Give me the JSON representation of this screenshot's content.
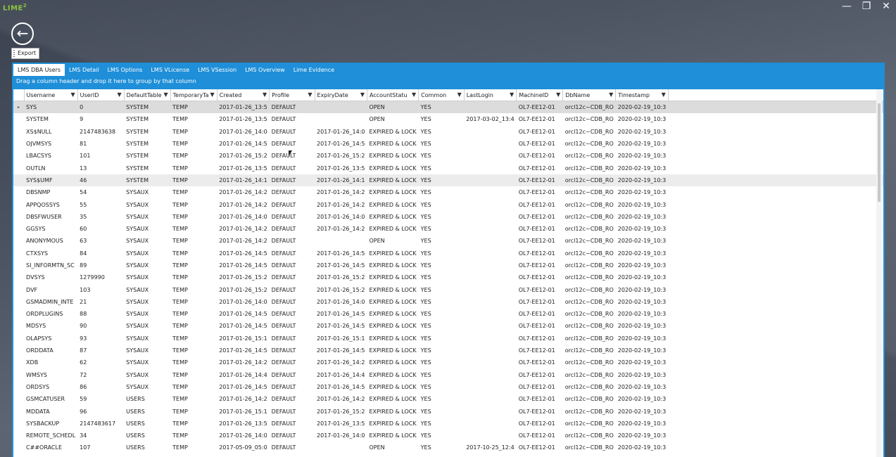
{
  "app": {
    "logo_text": "LIME",
    "logo_sup": "2"
  },
  "window_controls": {
    "minimize": "—",
    "maximize": "❐",
    "close": "✕"
  },
  "toolbar": {
    "export_label": "Export"
  },
  "tabs": [
    {
      "label": "LMS DBA Users",
      "active": true
    },
    {
      "label": "LMS Detail",
      "active": false
    },
    {
      "label": "LMS Options",
      "active": false
    },
    {
      "label": "LMS VLicense",
      "active": false
    },
    {
      "label": "LMS VSession",
      "active": false
    },
    {
      "label": "LMS Overview",
      "active": false
    },
    {
      "label": "Lime Evidence",
      "active": false
    }
  ],
  "group_hint": "Drag a column header and drop it here to group by that column",
  "grid": {
    "columns": [
      "Username",
      "UserID",
      "DefaultTable",
      "TemporaryTa",
      "Created",
      "Profile",
      "ExpiryDate",
      "AccountStatu",
      "Common",
      "LastLogin",
      "MachineID",
      "DbName",
      "Timestamp"
    ],
    "rows": [
      [
        "SYS",
        "0",
        "SYSTEM",
        "TEMP",
        "2017-01-26_13:5",
        "DEFAULT",
        "",
        "OPEN",
        "YES",
        "",
        "OL7-EE12-01",
        "orcl12c~CDB_RO",
        "2020-02-19_10:3"
      ],
      [
        "SYSTEM",
        "9",
        "SYSTEM",
        "TEMP",
        "2017-01-26_13:5",
        "DEFAULT",
        "",
        "OPEN",
        "YES",
        "2017-03-02_13:4",
        "OL7-EE12-01",
        "orcl12c~CDB_RO",
        "2020-02-19_10:3"
      ],
      [
        "XS$NULL",
        "2147483638",
        "SYSTEM",
        "TEMP",
        "2017-01-26_14:0",
        "DEFAULT",
        "2017-01-26_14:0",
        "EXPIRED & LOCK",
        "YES",
        "",
        "OL7-EE12-01",
        "orcl12c~CDB_RO",
        "2020-02-19_10:3"
      ],
      [
        "OJVMSYS",
        "81",
        "SYSTEM",
        "TEMP",
        "2017-01-26_14:5",
        "DEFAULT",
        "2017-01-26_14:5",
        "EXPIRED & LOCK",
        "YES",
        "",
        "OL7-EE12-01",
        "orcl12c~CDB_RO",
        "2020-02-19_10:3"
      ],
      [
        "LBACSYS",
        "101",
        "SYSTEM",
        "TEMP",
        "2017-01-26_15:2",
        "DEFAULT",
        "2017-01-26_15:2",
        "EXPIRED & LOCK",
        "YES",
        "",
        "OL7-EE12-01",
        "orcl12c~CDB_RO",
        "2020-02-19_10:3"
      ],
      [
        "OUTLN",
        "13",
        "SYSTEM",
        "TEMP",
        "2017-01-26_13:5",
        "DEFAULT",
        "2017-01-26_13:5",
        "EXPIRED & LOCK",
        "YES",
        "",
        "OL7-EE12-01",
        "orcl12c~CDB_RO",
        "2020-02-19_10:3"
      ],
      [
        "SYS$UMF",
        "46",
        "SYSTEM",
        "TEMP",
        "2017-01-26_14:1",
        "DEFAULT",
        "2017-01-26_14:1",
        "EXPIRED & LOCK",
        "YES",
        "",
        "OL7-EE12-01",
        "orcl12c~CDB_RO",
        "2020-02-19_10:3"
      ],
      [
        "DBSNMP",
        "54",
        "SYSAUX",
        "TEMP",
        "2017-01-26_14:2",
        "DEFAULT",
        "2017-01-26_14:2",
        "EXPIRED & LOCK",
        "YES",
        "",
        "OL7-EE12-01",
        "orcl12c~CDB_RO",
        "2020-02-19_10:3"
      ],
      [
        "APPQOSSYS",
        "55",
        "SYSAUX",
        "TEMP",
        "2017-01-26_14:2",
        "DEFAULT",
        "2017-01-26_14:2",
        "EXPIRED & LOCK",
        "YES",
        "",
        "OL7-EE12-01",
        "orcl12c~CDB_RO",
        "2020-02-19_10:3"
      ],
      [
        "DBSFWUSER",
        "35",
        "SYSAUX",
        "TEMP",
        "2017-01-26_14:0",
        "DEFAULT",
        "2017-01-26_14:0",
        "EXPIRED & LOCK",
        "YES",
        "",
        "OL7-EE12-01",
        "orcl12c~CDB_RO",
        "2020-02-19_10:3"
      ],
      [
        "GGSYS",
        "60",
        "SYSAUX",
        "TEMP",
        "2017-01-26_14:2",
        "DEFAULT",
        "2017-01-26_14:2",
        "EXPIRED & LOCK",
        "YES",
        "",
        "OL7-EE12-01",
        "orcl12c~CDB_RO",
        "2020-02-19_10:3"
      ],
      [
        "ANONYMOUS",
        "63",
        "SYSAUX",
        "TEMP",
        "2017-01-26_14:2",
        "DEFAULT",
        "",
        "OPEN",
        "YES",
        "",
        "OL7-EE12-01",
        "orcl12c~CDB_RO",
        "2020-02-19_10:3"
      ],
      [
        "CTXSYS",
        "84",
        "SYSAUX",
        "TEMP",
        "2017-01-26_14:5",
        "DEFAULT",
        "2017-01-26_14:5",
        "EXPIRED & LOCK",
        "YES",
        "",
        "OL7-EE12-01",
        "orcl12c~CDB_RO",
        "2020-02-19_10:3"
      ],
      [
        "SI_INFORMTN_SC",
        "89",
        "SYSAUX",
        "TEMP",
        "2017-01-26_14:5",
        "DEFAULT",
        "2017-01-26_14:5",
        "EXPIRED & LOCK",
        "YES",
        "",
        "OL7-EE12-01",
        "orcl12c~CDB_RO",
        "2020-02-19_10:3"
      ],
      [
        "DVSYS",
        "1279990",
        "SYSAUX",
        "TEMP",
        "2017-01-26_15:2",
        "DEFAULT",
        "2017-01-26_15:2",
        "EXPIRED & LOCK",
        "YES",
        "",
        "OL7-EE12-01",
        "orcl12c~CDB_RO",
        "2020-02-19_10:3"
      ],
      [
        "DVF",
        "103",
        "SYSAUX",
        "TEMP",
        "2017-01-26_15:2",
        "DEFAULT",
        "2017-01-26_15:2",
        "EXPIRED & LOCK",
        "YES",
        "",
        "OL7-EE12-01",
        "orcl12c~CDB_RO",
        "2020-02-19_10:3"
      ],
      [
        "GSMADMIN_INTE",
        "21",
        "SYSAUX",
        "TEMP",
        "2017-01-26_14:0",
        "DEFAULT",
        "2017-01-26_14:0",
        "EXPIRED & LOCK",
        "YES",
        "",
        "OL7-EE12-01",
        "orcl12c~CDB_RO",
        "2020-02-19_10:3"
      ],
      [
        "ORDPLUGINS",
        "88",
        "SYSAUX",
        "TEMP",
        "2017-01-26_14:5",
        "DEFAULT",
        "2017-01-26_14:5",
        "EXPIRED & LOCK",
        "YES",
        "",
        "OL7-EE12-01",
        "orcl12c~CDB_RO",
        "2020-02-19_10:3"
      ],
      [
        "MDSYS",
        "90",
        "SYSAUX",
        "TEMP",
        "2017-01-26_14:5",
        "DEFAULT",
        "2017-01-26_14:5",
        "EXPIRED & LOCK",
        "YES",
        "",
        "OL7-EE12-01",
        "orcl12c~CDB_RO",
        "2020-02-19_10:3"
      ],
      [
        "OLAPSYS",
        "93",
        "SYSAUX",
        "TEMP",
        "2017-01-26_15:1",
        "DEFAULT",
        "2017-01-26_15:1",
        "EXPIRED & LOCK",
        "YES",
        "",
        "OL7-EE12-01",
        "orcl12c~CDB_RO",
        "2020-02-19_10:3"
      ],
      [
        "ORDDATA",
        "87",
        "SYSAUX",
        "TEMP",
        "2017-01-26_14:5",
        "DEFAULT",
        "2017-01-26_14:5",
        "EXPIRED & LOCK",
        "YES",
        "",
        "OL7-EE12-01",
        "orcl12c~CDB_RO",
        "2020-02-19_10:3"
      ],
      [
        "XDB",
        "62",
        "SYSAUX",
        "TEMP",
        "2017-01-26_14:2",
        "DEFAULT",
        "2017-01-26_14:2",
        "EXPIRED & LOCK",
        "YES",
        "",
        "OL7-EE12-01",
        "orcl12c~CDB_RO",
        "2020-02-19_10:3"
      ],
      [
        "WMSYS",
        "72",
        "SYSAUX",
        "TEMP",
        "2017-01-26_14:4",
        "DEFAULT",
        "2017-01-26_14:4",
        "EXPIRED & LOCK",
        "YES",
        "",
        "OL7-EE12-01",
        "orcl12c~CDB_RO",
        "2020-02-19_10:3"
      ],
      [
        "ORDSYS",
        "86",
        "SYSAUX",
        "TEMP",
        "2017-01-26_14:5",
        "DEFAULT",
        "2017-01-26_14:5",
        "EXPIRED & LOCK",
        "YES",
        "",
        "OL7-EE12-01",
        "orcl12c~CDB_RO",
        "2020-02-19_10:3"
      ],
      [
        "GSMCATUSER",
        "59",
        "USERS",
        "TEMP",
        "2017-01-26_14:2",
        "DEFAULT",
        "2017-01-26_14:2",
        "EXPIRED & LOCK",
        "YES",
        "",
        "OL7-EE12-01",
        "orcl12c~CDB_RO",
        "2020-02-19_10:3"
      ],
      [
        "MDDATA",
        "96",
        "USERS",
        "TEMP",
        "2017-01-26_15:1",
        "DEFAULT",
        "2017-01-26_15:2",
        "EXPIRED & LOCK",
        "YES",
        "",
        "OL7-EE12-01",
        "orcl12c~CDB_RO",
        "2020-02-19_10:3"
      ],
      [
        "SYSBACKUP",
        "2147483617",
        "USERS",
        "TEMP",
        "2017-01-26_13:5",
        "DEFAULT",
        "2017-01-26_13:5",
        "EXPIRED & LOCK",
        "YES",
        "",
        "OL7-EE12-01",
        "orcl12c~CDB_RO",
        "2020-02-19_10:3"
      ],
      [
        "REMOTE_SCHEDL",
        "34",
        "USERS",
        "TEMP",
        "2017-01-26_14:0",
        "DEFAULT",
        "2017-01-26_14:0",
        "EXPIRED & LOCK",
        "YES",
        "",
        "OL7-EE12-01",
        "orcl12c~CDB_RO",
        "2020-02-19_10:3"
      ],
      [
        "C##ORACLE",
        "107",
        "USERS",
        "TEMP",
        "2017-05-09_05:0",
        "DEFAULT",
        "",
        "OPEN",
        "YES",
        "2017-10-25_12:4",
        "OL7-EE12-01",
        "orcl12c~CDB_RO",
        "2020-02-19_10:3"
      ]
    ],
    "selected_row": 0,
    "highlighted_row": 6,
    "row_indicator": "▸",
    "filter_icon": "filter-icon"
  }
}
